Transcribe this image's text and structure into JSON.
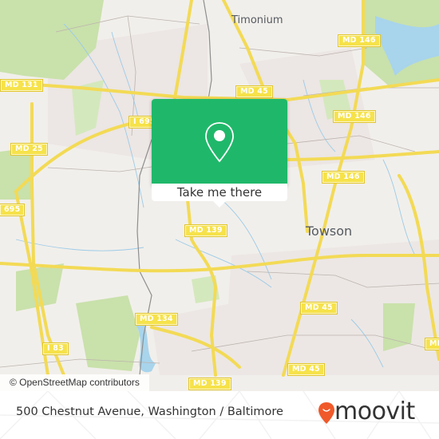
{
  "map": {
    "attribution": "© OpenStreetMap contributors",
    "places": [
      {
        "id": "timonium",
        "label": "Timonium"
      },
      {
        "id": "towson",
        "label": "Towson"
      }
    ],
    "route_shields": [
      {
        "id": "md131",
        "label": "MD 131"
      },
      {
        "id": "i695-top",
        "label": "I 695"
      },
      {
        "id": "md25",
        "label": "MD 25"
      },
      {
        "id": "i695-left",
        "label": "695"
      },
      {
        "id": "md45-top",
        "label": "MD 45"
      },
      {
        "id": "md146-a",
        "label": "MD 146"
      },
      {
        "id": "md146-b",
        "label": "MD 146"
      },
      {
        "id": "md146-c",
        "label": "MD 146"
      },
      {
        "id": "md139-mid",
        "label": "MD 139"
      },
      {
        "id": "md134",
        "label": "MD 134"
      },
      {
        "id": "i83",
        "label": "I 83"
      },
      {
        "id": "md45-mid",
        "label": "MD 45"
      },
      {
        "id": "md45-low",
        "label": "MD 45"
      },
      {
        "id": "md139-low",
        "label": "MD 139"
      },
      {
        "id": "md-right",
        "label": "MD"
      }
    ]
  },
  "popup": {
    "icon": "map-pin-icon",
    "button_label": "Take me there"
  },
  "footer": {
    "address": "500 Chestnut Avenue, Washington / Baltimore",
    "brand": "moovit"
  },
  "colors": {
    "popup_green": "#1fb86a",
    "road_yellow": "#f6e24a",
    "brand_orange": "#f0592a",
    "water": "#a8d4ec",
    "park": "#c8e0a8"
  }
}
